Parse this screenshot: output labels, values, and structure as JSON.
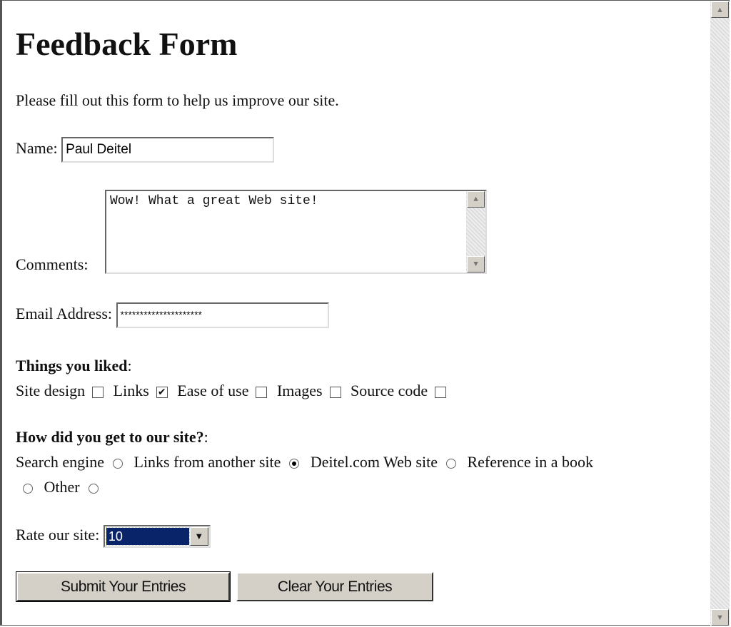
{
  "title": "Feedback Form",
  "intro": "Please fill out this form to help us improve our site.",
  "name": {
    "label": "Name:",
    "value": "Paul Deitel"
  },
  "comments": {
    "label": "Comments:",
    "value": "Wow! What a great Web site!"
  },
  "email": {
    "label": "Email Address:",
    "value": "*********************"
  },
  "liked": {
    "heading": "Things you liked",
    "colon": ":",
    "items": [
      {
        "label": "Site design",
        "checked": false
      },
      {
        "label": "Links",
        "checked": true
      },
      {
        "label": "Ease of use",
        "checked": false
      },
      {
        "label": "Images",
        "checked": false
      },
      {
        "label": "Source code",
        "checked": false
      }
    ]
  },
  "how": {
    "heading": "How did you get to our site?",
    "colon": ":",
    "items": [
      {
        "label": "Search engine",
        "checked": false
      },
      {
        "label": "Links from another site",
        "checked": true
      },
      {
        "label": "Deitel.com Web site",
        "checked": false
      },
      {
        "label": "Reference in a book",
        "checked": false
      },
      {
        "label": "Other",
        "checked": false
      }
    ]
  },
  "rate": {
    "label": "Rate our site:",
    "value": "10"
  },
  "buttons": {
    "submit": "Submit Your Entries",
    "clear": "Clear Your Entries"
  },
  "icons": {
    "scroll_up": "triangle-up",
    "scroll_down": "triangle-down",
    "dropdown": "triangle-down",
    "check": "✔"
  },
  "colors": {
    "selection": "#0a246a",
    "button_face": "#d4d0c8"
  }
}
